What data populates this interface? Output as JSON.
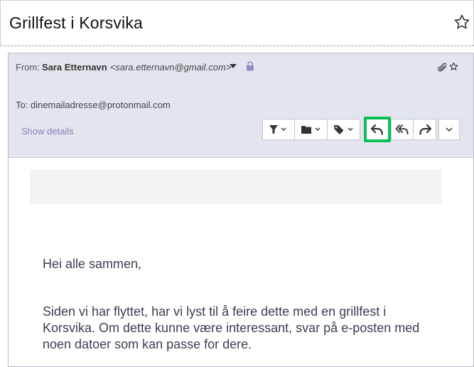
{
  "subject": "Grillfest i Korsvika",
  "header": {
    "from_label": "From:",
    "from_name": "Sara Etternavn",
    "from_email": "<sara.etternavn@gmail.com>",
    "to_label": "To:",
    "to_address": "dinemailadresse@protonmail.com",
    "show_details": "Show details"
  },
  "toolbar": {
    "buttons": [
      "filter-icon",
      "folder-icon",
      "label-icon",
      "reply-icon",
      "reply-all-icon",
      "forward-icon",
      "more-icon"
    ],
    "highlight_color": "#0bbf5a"
  },
  "body": {
    "greeting": "Hei alle sammen,",
    "paragraph": "Siden vi har flyttet, har vi lyst til å feire dette med en grillfest i Korsvika. Om dette kunne være interessant, svar på e-posten med noen datoer som kan passe for dere."
  }
}
